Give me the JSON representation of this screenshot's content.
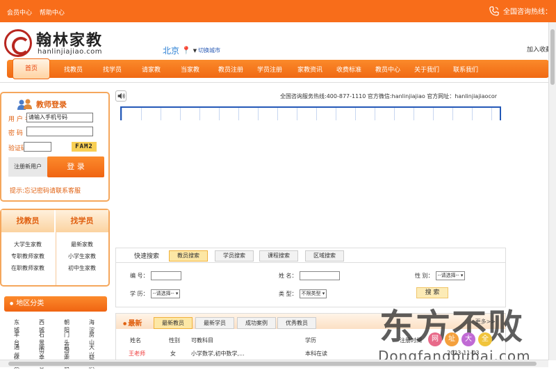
{
  "topbar": {
    "links": [
      "会员中心",
      "帮助中心"
    ],
    "phone": "全国咨询热线：",
    "phone_icon": "phone-icon"
  },
  "logo": {
    "name": "翰林家教",
    "domain": "hanlinjiajiao.com"
  },
  "city": {
    "name": "北京",
    "switch": "切换城市"
  },
  "header_right": "加入收藏",
  "nav": {
    "items": [
      "首页",
      "找教员",
      "找学员",
      "请家教",
      "当家教",
      "教员注册",
      "学员注册",
      "家教资讯",
      "收费标准",
      "教员中心",
      "关于我们",
      "联系我们"
    ],
    "active_index": 0
  },
  "login": {
    "title": "教师登录",
    "user_label": "用 户 名",
    "user_value": "请输入手机号码",
    "pass_label": "密 码",
    "code_label": "验证码",
    "captcha": "FAM2",
    "register": "注册新用户",
    "submit": "登  录",
    "footer": "提示:忘记密码请联系客服"
  },
  "categories": {
    "left": {
      "head": "找教员",
      "items": [
        "大学生家教",
        "专职教师家教",
        "在职教师家教"
      ]
    },
    "right": {
      "head": "找学员",
      "items": [
        "最新家教",
        "小学生家教",
        "初中生家教"
      ]
    }
  },
  "areas": {
    "title": "地区分类",
    "items": [
      "东城",
      "西城",
      "朝阳",
      "海淀",
      "丰台",
      "石景山",
      "门头沟",
      "房山",
      "通州",
      "顺义",
      "昌平",
      "大兴",
      "怀柔",
      "平谷",
      "密云",
      "延庆"
    ]
  },
  "announce": {
    "speaker_icon": "speaker-icon",
    "text": "全国咨询服务热线:400-877-1110 官方微信:hanlinjiajiao 官方网址：hanlinjiajiaocom 欢迎您！"
  },
  "search": {
    "label": "快速搜索",
    "tabs": [
      "教员搜索",
      "学员搜索",
      "课程搜索",
      "区域搜索"
    ],
    "active_tab": 0,
    "fields": {
      "f1": "编 号：",
      "f2": "姓 名：",
      "f3": "性 别：",
      "f3_value": "--请选择--",
      "f4": "学 历：",
      "f4_value": "--请选择--",
      "f5": "类 型：",
      "f5_value": "不限类型"
    },
    "button": "搜 索"
  },
  "latest": {
    "title": "最新",
    "tabs": [
      "最新教员",
      "最新学员",
      "成功案例",
      "优秀教员"
    ],
    "active_tab": 0,
    "more": "更多>>",
    "columns": [
      "姓名",
      "性别",
      "可教科目",
      "学历",
      "注册时间"
    ],
    "row": {
      "name": "王老师",
      "gender": "女",
      "subjects": "小学数学,初中数学,...",
      "edu": "本科在读",
      "date": "2023-11-03"
    }
  },
  "watermark": {
    "big": "东方不败",
    "dots": [
      "网",
      "址",
      "大",
      "全"
    ],
    "sub": "Dongfangbubai.com"
  }
}
